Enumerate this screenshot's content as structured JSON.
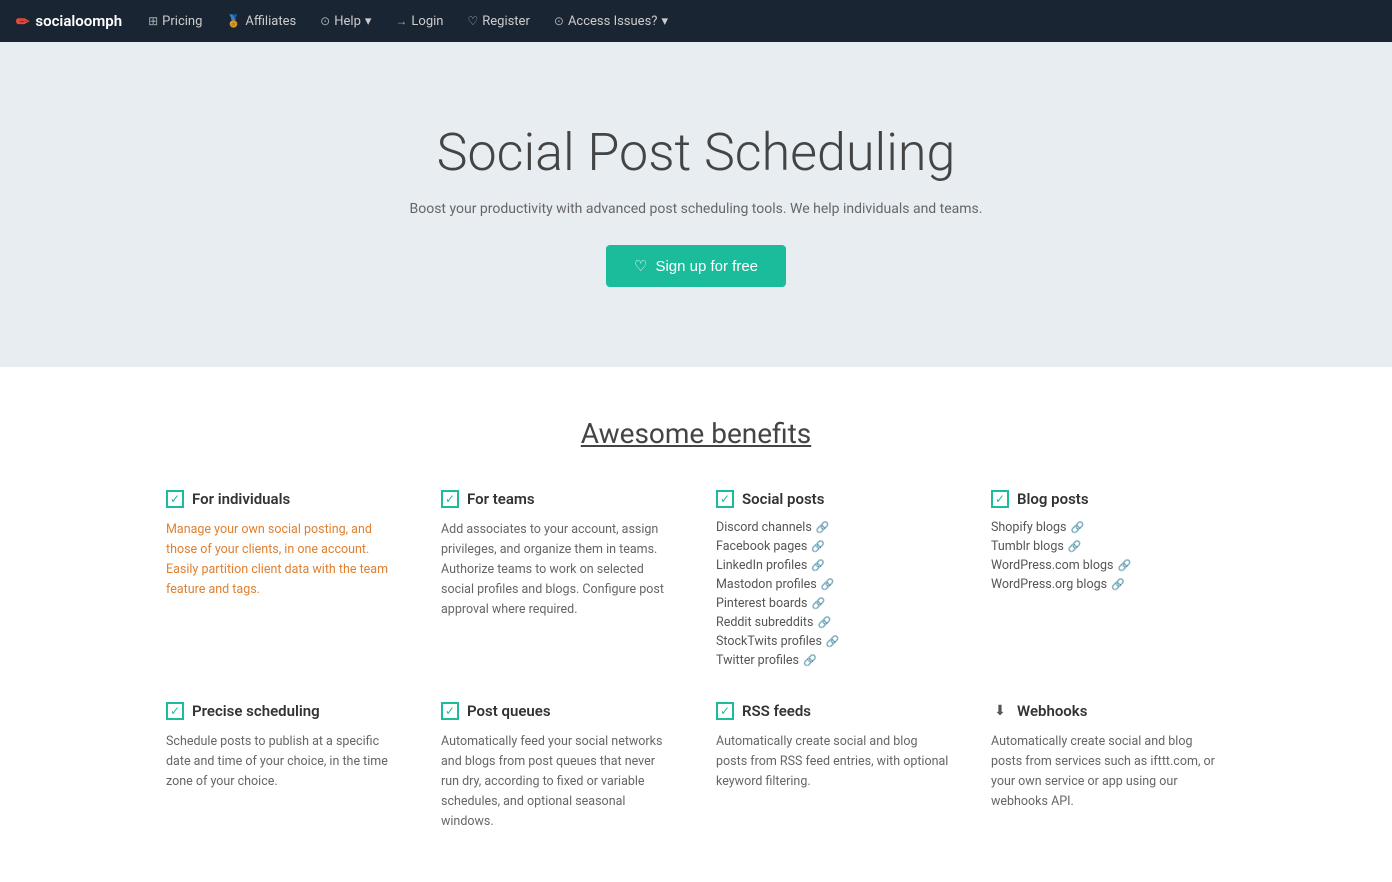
{
  "nav": {
    "brand": "socialoomph",
    "brand_icon": "✏",
    "links": [
      {
        "id": "pricing",
        "icon": "⊞",
        "label": "Pricing"
      },
      {
        "id": "affiliates",
        "icon": "🏅",
        "label": "Affiliates"
      },
      {
        "id": "help",
        "icon": "⊙",
        "label": "Help",
        "has_dropdown": true
      },
      {
        "id": "login",
        "icon": "→",
        "label": "Login"
      },
      {
        "id": "register",
        "icon": "♡",
        "label": "Register"
      },
      {
        "id": "access",
        "icon": "⊙",
        "label": "Access Issues?",
        "has_dropdown": true
      }
    ]
  },
  "hero": {
    "title": "Social Post Scheduling",
    "subtitle": "Boost your productivity with advanced post scheduling tools. We help individuals and teams.",
    "button_label": "Sign up for free",
    "button_icon": "♡"
  },
  "benefits": {
    "section_title": "Awesome benefits",
    "cards": [
      {
        "id": "individuals",
        "type": "check",
        "title": "For individuals",
        "desc_type": "orange",
        "desc": "Manage your own social posting, and those of your clients, in one account. Easily partition client data with the team feature and tags.",
        "items": []
      },
      {
        "id": "teams",
        "type": "check",
        "title": "For teams",
        "desc_type": "dark",
        "desc": "Add associates to your account, assign privileges, and organize them in teams. Authorize teams to work on selected social profiles and blogs. Configure post approval where required.",
        "items": []
      },
      {
        "id": "social-posts",
        "type": "check",
        "title": "Social posts",
        "desc_type": "list",
        "desc": "",
        "items": [
          "Discord channels",
          "Facebook pages",
          "LinkedIn profiles",
          "Mastodon profiles",
          "Pinterest boards",
          "Reddit subreddits",
          "StockTwits profiles",
          "Twitter profiles"
        ]
      },
      {
        "id": "blog-posts",
        "type": "check",
        "title": "Blog posts",
        "desc_type": "list",
        "desc": "",
        "items": [
          "Shopify blogs",
          "Tumblr blogs",
          "WordPress.com blogs",
          "WordPress.org blogs"
        ]
      },
      {
        "id": "precise-scheduling",
        "type": "check",
        "title": "Precise scheduling",
        "desc_type": "dark",
        "desc": "Schedule posts to publish at a specific date and time of your choice, in the time zone of your choice.",
        "items": []
      },
      {
        "id": "post-queues",
        "type": "check",
        "title": "Post queues",
        "desc_type": "dark",
        "desc": "Automatically feed your social networks and blogs from post queues that never run dry, according to fixed or variable schedules, and optional seasonal windows.",
        "items": []
      },
      {
        "id": "rss-feeds",
        "type": "check",
        "title": "RSS feeds",
        "desc_type": "dark",
        "desc": "Automatically create social and blog posts from RSS feed entries, with optional keyword filtering.",
        "items": []
      },
      {
        "id": "webhooks",
        "type": "webhook",
        "title": "Webhooks",
        "desc_type": "dark",
        "desc": "Automatically create social and blog posts from services such as ifttt.com, or your own service or app using our webhooks API.",
        "items": []
      }
    ]
  }
}
